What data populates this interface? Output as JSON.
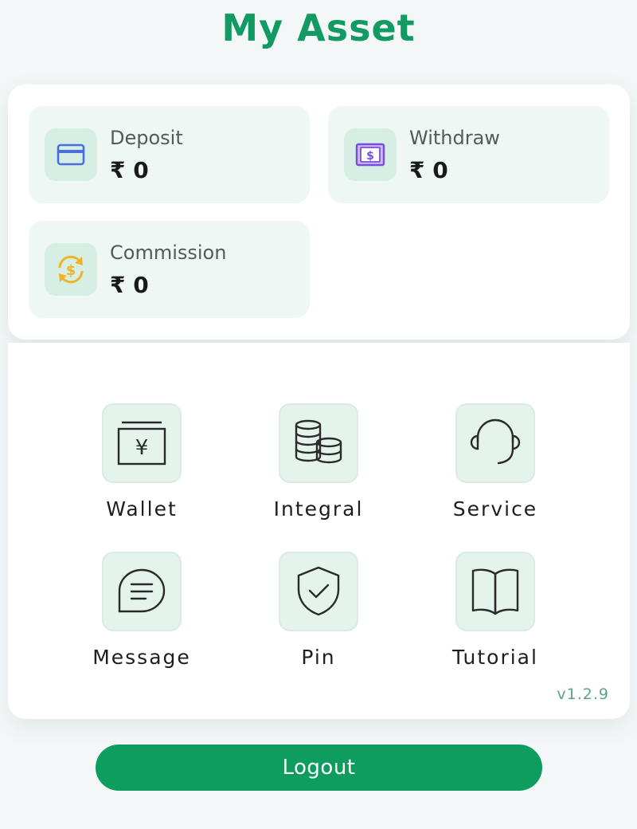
{
  "header": {
    "title": "My Asset"
  },
  "assets": [
    {
      "label": "Deposit",
      "value": "₹ 0",
      "icon": "credit-card-icon",
      "color": "#4a6fdc"
    },
    {
      "label": "Withdraw",
      "value": "₹ 0",
      "icon": "cash-icon",
      "color": "#7a4fd8"
    },
    {
      "label": "Commission",
      "value": "₹ 0",
      "icon": "currency-exchange-icon",
      "color": "#f0b429"
    }
  ],
  "menu": [
    {
      "label": "Wallet",
      "icon": "wallet-icon"
    },
    {
      "label": "Integral",
      "icon": "coins-icon"
    },
    {
      "label": "Service",
      "icon": "headset-icon"
    },
    {
      "label": "Message",
      "icon": "chat-bubble-icon"
    },
    {
      "label": "Pin",
      "icon": "shield-check-icon"
    },
    {
      "label": "Tutorial",
      "icon": "book-icon"
    }
  ],
  "version": "v1.2.9",
  "logout_label": "Logout",
  "colors": {
    "brand": "#129a63",
    "button": "#0e9c5f",
    "tile": "#eef7f3"
  }
}
